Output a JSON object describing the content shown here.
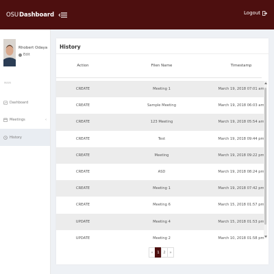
{
  "brand": {
    "light": "OSU",
    "bold": "Dashboard"
  },
  "topbar": {
    "logout_label": "Logout"
  },
  "user": {
    "name": "Rhobert Odaya",
    "edit_label": "Edit"
  },
  "sidebar": {
    "section_label": "MAIN",
    "items": [
      {
        "label": "Dashboard",
        "icon": "dashboard-icon"
      },
      {
        "label": "Meetings",
        "icon": "meetings-icon"
      },
      {
        "label": "History",
        "icon": "history-icon"
      }
    ]
  },
  "history": {
    "title": "History",
    "columns": [
      "Action",
      "Filen Name",
      "Timestamp"
    ],
    "rows": [
      [
        "CREATE",
        "Meeting 1",
        "March 19, 2018 07:01 am"
      ],
      [
        "CREATE",
        "Sample Meeting",
        "March 19, 2018 06:03 am"
      ],
      [
        "CREATE",
        "123 Meeting",
        "March 19, 2018 05:54 am"
      ],
      [
        "CREATE",
        "Test",
        "March 19, 2018 09:44 pm"
      ],
      [
        "CREATE",
        "Meeting",
        "March 19, 2018 09:22 pm"
      ],
      [
        "CREATE",
        "ASD",
        "March 19, 2018 08:24 pm"
      ],
      [
        "CREATE",
        "Meeting 1",
        "March 19, 2018 07:42 pm"
      ],
      [
        "CREATE",
        "Meeting 6",
        "March 15, 2018 01:57 pm"
      ],
      [
        "UPDATE",
        "Meeting 4",
        "March 15, 2018 01:53 pm"
      ],
      [
        "UPDATE",
        "Meeting 2",
        "March 10, 2018 01:58 pm"
      ]
    ]
  },
  "pagination": {
    "prev": "«",
    "pages": [
      "1",
      "2"
    ],
    "next": "»",
    "current": "1"
  },
  "colors": {
    "accent": "#4d0f0f",
    "row_stripe": "#ececec",
    "active_nav": "#e9edf2"
  }
}
